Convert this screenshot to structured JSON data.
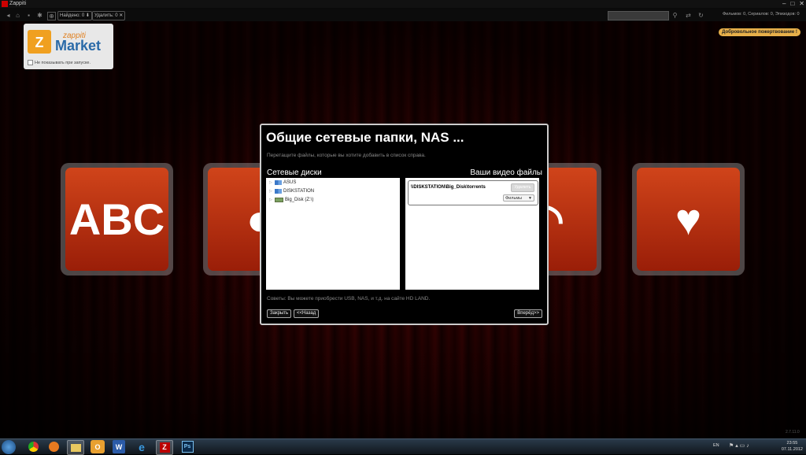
{
  "window": {
    "title": "Zappiti",
    "controls": [
      "–",
      "□",
      "✕"
    ]
  },
  "toolbar": {
    "found_label": "Найдено: 0",
    "removed_label": "Удалить: 0",
    "counts": "Фильмов: 0, Сериалов: 0, Эпизодов: 0"
  },
  "donate_label": "Добровольное пожертвование !",
  "market": {
    "brand_small": "zappiti",
    "brand_large": "Market",
    "checkbox_label": "Не показывать при запуске."
  },
  "tiles": [
    {
      "icon": "abc-icon",
      "glyph": "ABC"
    },
    {
      "icon": "camera-icon",
      "glyph": "●"
    },
    {
      "icon": "hidden-icon",
      "glyph": ""
    },
    {
      "icon": "arc-icon",
      "glyph": "◠"
    },
    {
      "icon": "gun-heart-icon",
      "glyph": "♥"
    }
  ],
  "dialog": {
    "title": "Общие сетевые папки, NAS ...",
    "subtitle": "Перетащите файлы, которые вы хотите добавить в список справа.",
    "left_header": "Сетевые диски",
    "right_header": "Ваши видео файлы",
    "tree": [
      {
        "label": "ASUS",
        "icon": "network-icon"
      },
      {
        "label": "DISKSTATION",
        "icon": "network-icon"
      },
      {
        "label": "Big_Disk (Z:\\)",
        "icon": "drive-icon"
      }
    ],
    "video_item": {
      "path": "\\\\DISKSTATION\\Big_Disk\\torrents",
      "delete_label": "Удалить",
      "type_value": "Фильмы"
    },
    "tip": "Советы: Вы можете приобрести USB, NAS, и т.д. на сайте HD LAND.",
    "close_label": "Закрыть",
    "back_label": "<<Назад",
    "next_label": "Вперёд>>"
  },
  "taskbar": {
    "lang": "EN",
    "time": "23:55",
    "date": "07.11.2012"
  },
  "version": "2.7.11.0"
}
